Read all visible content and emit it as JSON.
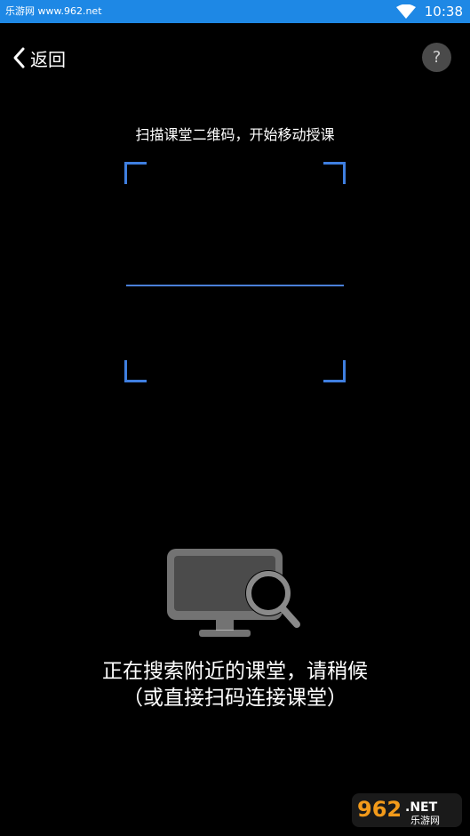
{
  "status_bar": {
    "watermark_text": "乐游网 www.962.net",
    "time": "10:38",
    "background_color": "#1e88e5",
    "icons": [
      "wifi-icon"
    ]
  },
  "header": {
    "back_label": "返回",
    "back_icon": "chevron-left-icon",
    "help_label": "?"
  },
  "scanner": {
    "instruction": "扫描课堂二维码，开始移动授课",
    "accent_color": "#3f7fe0"
  },
  "searching": {
    "icon": "monitor-search-icon",
    "line1": "正在搜索附近的课堂，请稍候",
    "line2": "（或直接扫码连接课堂）"
  },
  "watermark": {
    "logo_number": "962",
    "logo_suffix": ".NET",
    "logo_subtitle": "乐游网"
  }
}
